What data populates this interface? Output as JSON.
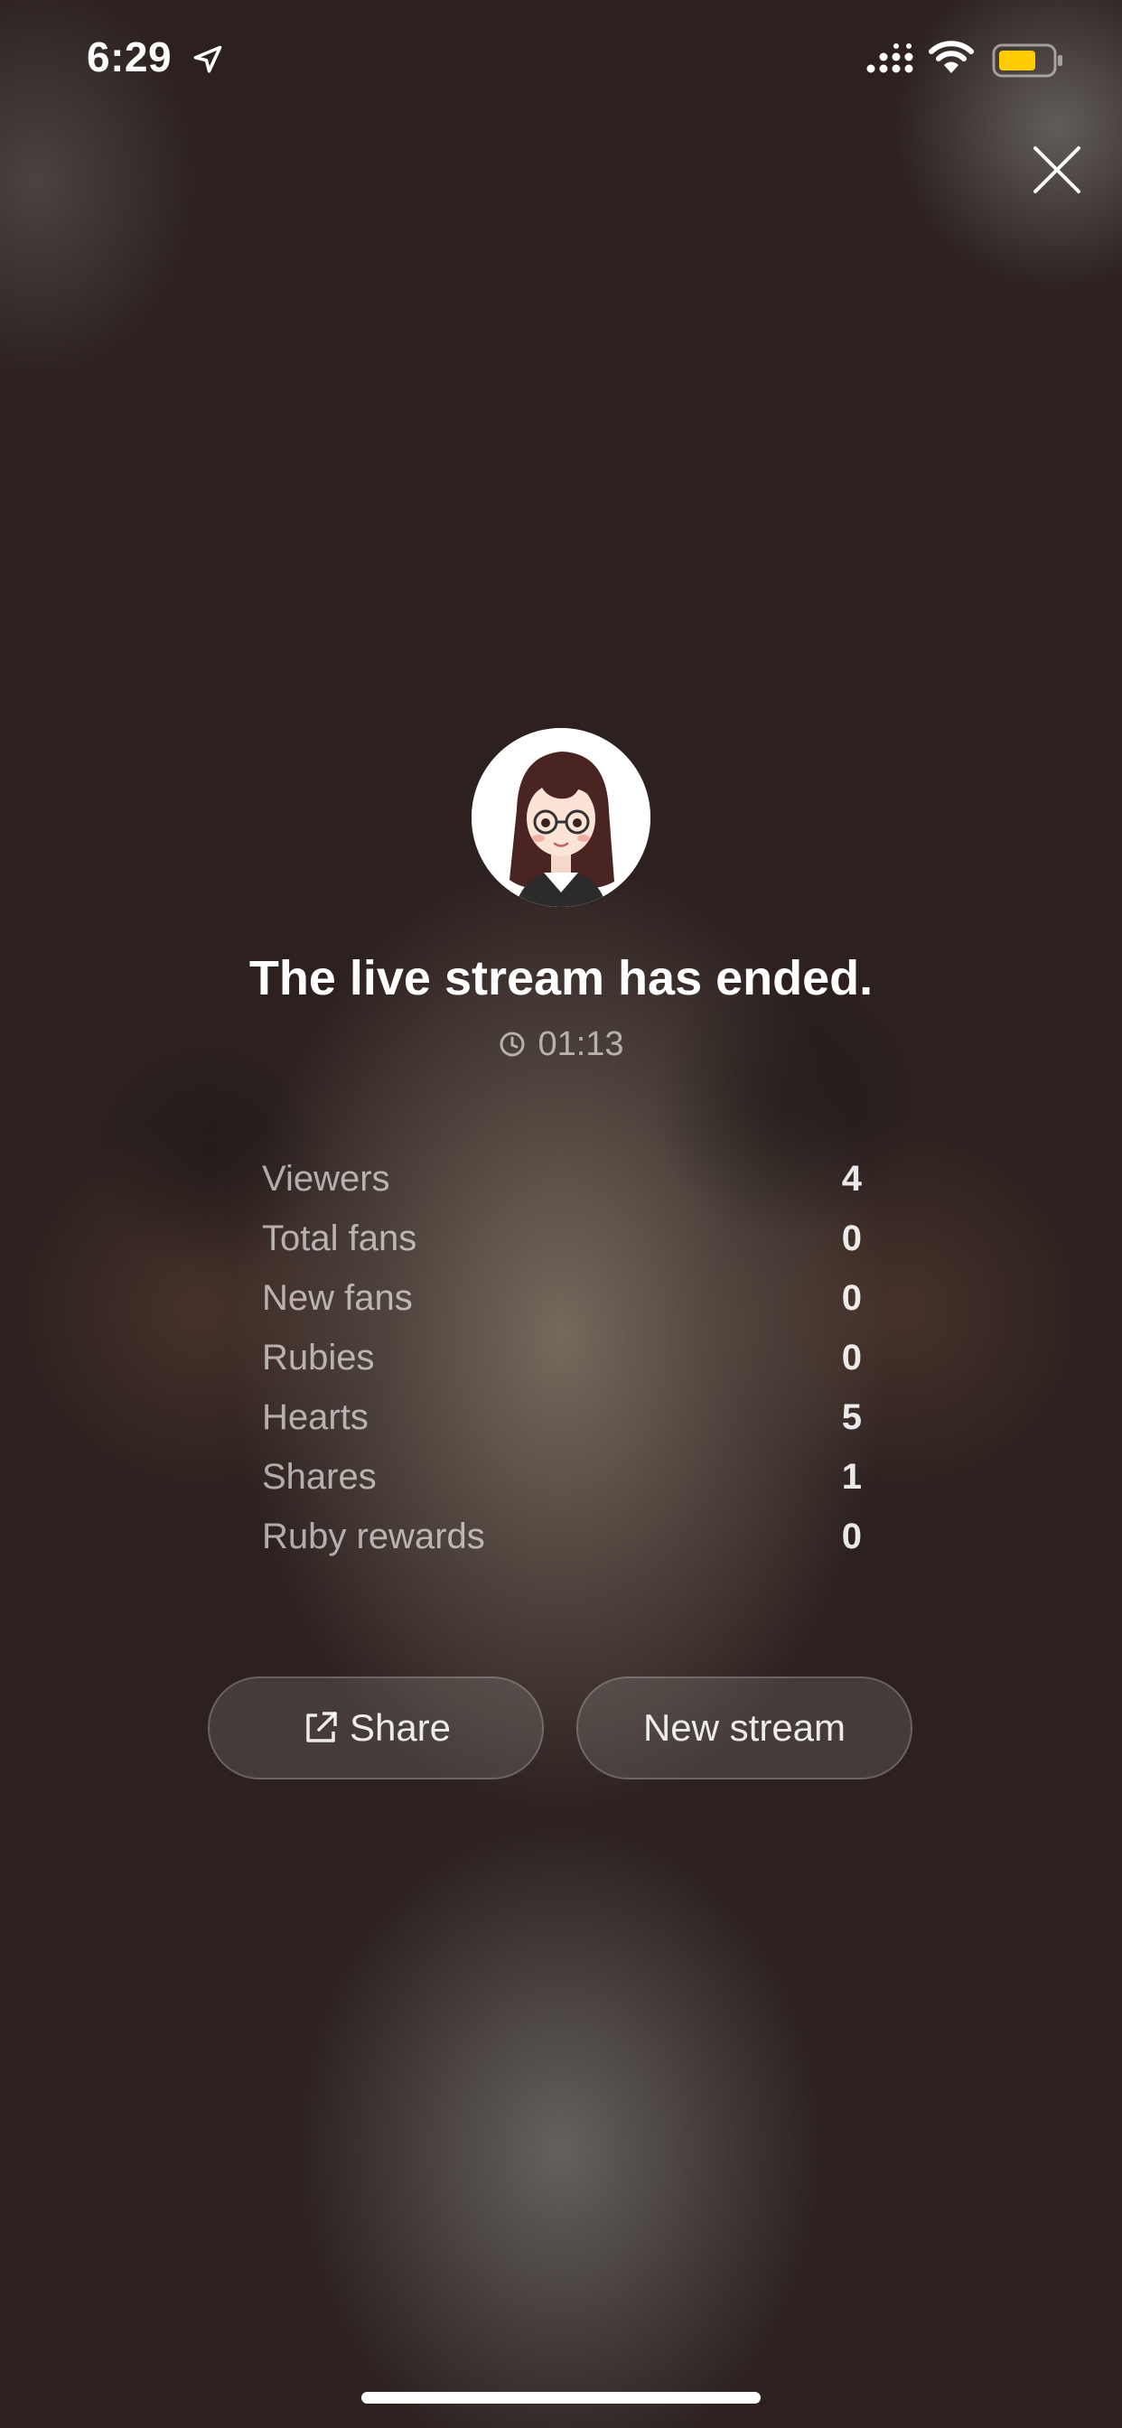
{
  "status_bar": {
    "time": "6:29",
    "icons": [
      "location-arrow-icon",
      "signal-icon",
      "wifi-icon",
      "battery-icon"
    ],
    "battery_color": "#FFCC00"
  },
  "close_icon": "close-icon",
  "avatar_icon": "avatar-cartoon-girl",
  "title": "The live stream has ended.",
  "duration": "01:13",
  "stats": [
    {
      "label": "Viewers",
      "value": "4"
    },
    {
      "label": "Total fans",
      "value": "0"
    },
    {
      "label": "New fans",
      "value": "0"
    },
    {
      "label": "Rubies",
      "value": "0"
    },
    {
      "label": "Hearts",
      "value": "5"
    },
    {
      "label": "Shares",
      "value": "1"
    },
    {
      "label": "Ruby rewards",
      "value": "0"
    }
  ],
  "buttons": {
    "share_label": "Share",
    "new_stream_label": "New stream"
  }
}
